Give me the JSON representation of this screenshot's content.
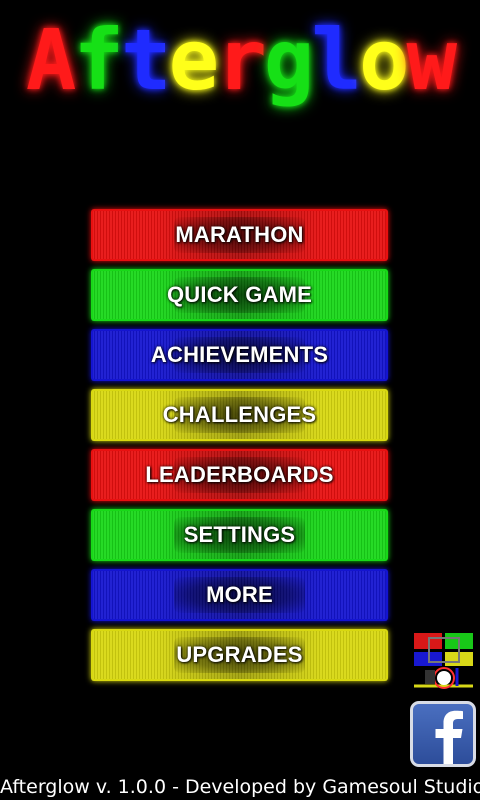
{
  "logo": {
    "text": "Afterglow",
    "letters": [
      {
        "char": "A",
        "color": "#ff1a1a"
      },
      {
        "char": "f",
        "color": "#16e016"
      },
      {
        "char": "t",
        "color": "#1f2bff"
      },
      {
        "char": "e",
        "color": "#ffff1a"
      },
      {
        "char": "r",
        "color": "#ff1a1a"
      },
      {
        "char": "g",
        "color": "#16e016"
      },
      {
        "char": "l",
        "color": "#1f2bff"
      },
      {
        "char": "o",
        "color": "#ffff1a"
      },
      {
        "char": "w",
        "color": "#ff1a1a"
      }
    ]
  },
  "menu": [
    {
      "id": "marathon",
      "label": "MARATHON",
      "color": "red"
    },
    {
      "id": "quick-game",
      "label": "QUICK GAME",
      "color": "green"
    },
    {
      "id": "achievements",
      "label": "ACHIEVEMENTS",
      "color": "blue"
    },
    {
      "id": "challenges",
      "label": "CHALLENGES",
      "color": "yellow"
    },
    {
      "id": "leaderboards",
      "label": "LEADERBOARDS",
      "color": "red"
    },
    {
      "id": "settings",
      "label": "SETTINGS",
      "color": "green"
    },
    {
      "id": "more",
      "label": "MORE",
      "color": "blue"
    },
    {
      "id": "upgrades",
      "label": "UPGRADES",
      "color": "yellow"
    }
  ],
  "colors": {
    "red": "#e81010",
    "green": "#18d818",
    "blue": "#1414d0",
    "yellow": "#d8d810",
    "background": "#000000"
  },
  "icons": {
    "afterglow_app": "afterglow-mini-icon",
    "facebook": "facebook-icon"
  },
  "footer": {
    "text": "Afterglow v. 1.0.0 - Developed by Gamesoul Studio"
  }
}
